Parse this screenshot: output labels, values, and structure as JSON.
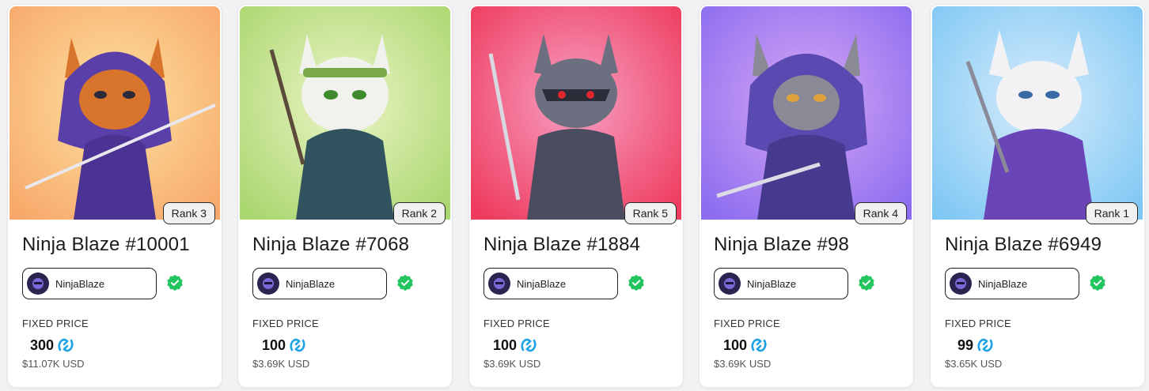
{
  "cards": [
    {
      "name": "Ninja Blaze #10001",
      "rank": "Rank 3",
      "creator": "NinjaBlaze",
      "price_label": "FIXED PRICE",
      "price": "300",
      "usd": "$11.07K USD",
      "bg": [
        "#f7a86a",
        "#fde3a0"
      ],
      "hood": "#5b3fa8",
      "face": "#d8742c"
    },
    {
      "name": "Ninja Blaze #7068",
      "rank": "Rank 2",
      "creator": "NinjaBlaze",
      "price_label": "FIXED PRICE",
      "price": "100",
      "usd": "$3.69K USD",
      "bg": [
        "#a9d66e",
        "#ecf5c6"
      ],
      "hood": "#31525f",
      "face": "#f1f1ee"
    },
    {
      "name": "Ninja Blaze #1884",
      "rank": "Rank 5",
      "creator": "NinjaBlaze",
      "price_label": "FIXED PRICE",
      "price": "100",
      "usd": "$3.69K USD",
      "bg": [
        "#ee3a5c",
        "#f7a0c4"
      ],
      "hood": "#4a4d60",
      "face": "#6b6f80"
    },
    {
      "name": "Ninja Blaze #98",
      "rank": "Rank 4",
      "creator": "NinjaBlaze",
      "price_label": "FIXED PRICE",
      "price": "100",
      "usd": "$3.69K USD",
      "bg": [
        "#8b6cf0",
        "#d7a8f3"
      ],
      "hood": "#5a49b0",
      "face": "#8a8a96"
    },
    {
      "name": "Ninja Blaze #6949",
      "rank": "Rank 1",
      "creator": "NinjaBlaze",
      "price_label": "FIXED PRICE",
      "price": "99",
      "usd": "$3.65K USD",
      "bg": [
        "#7fc7f4",
        "#d6ecfb"
      ],
      "hood": "#6a45b8",
      "face": "#f2f2f4"
    }
  ],
  "colors": {
    "verified": "#22c55e",
    "coin": "#1fa2e6",
    "avatar_bg": "#2b2450"
  }
}
